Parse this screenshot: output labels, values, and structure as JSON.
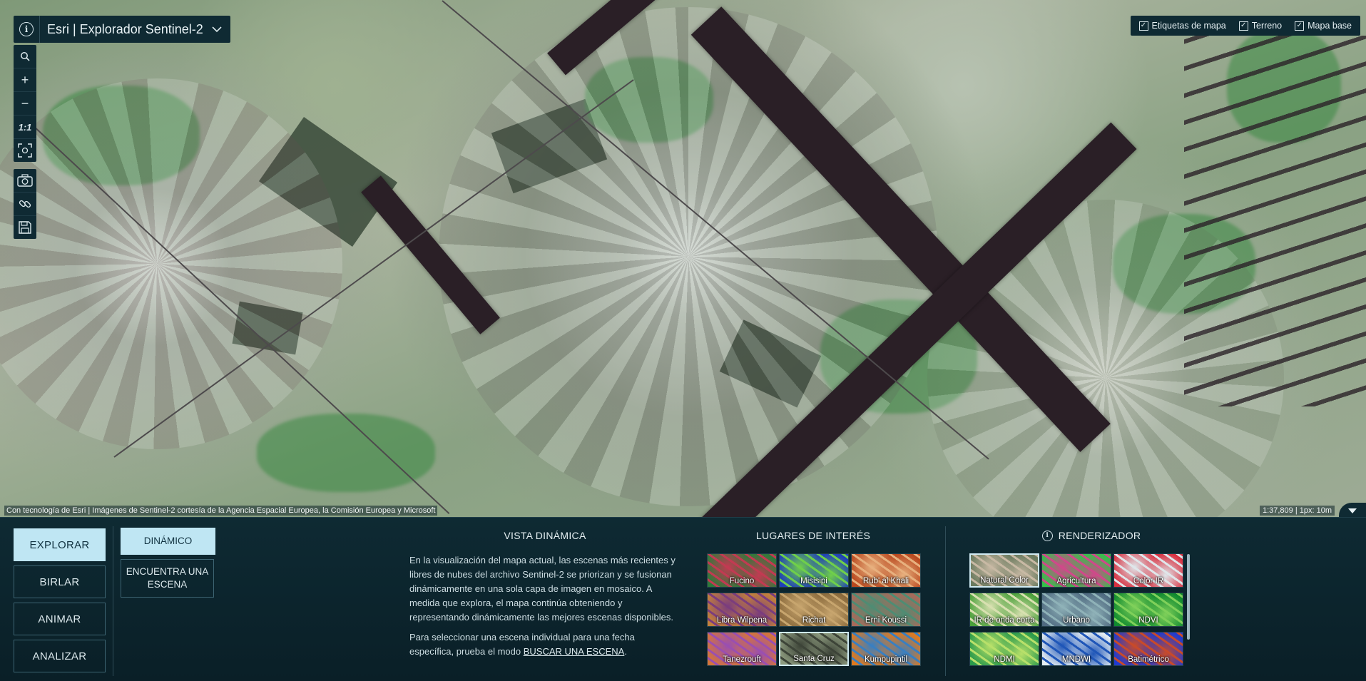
{
  "app": {
    "title": "Esri | Explorador Sentinel-2"
  },
  "map_tools": {
    "search": "search-icon",
    "zoom_in": "+",
    "zoom_out": "−",
    "scale_one": "1:1",
    "fullscreen": "fullscreen-icon",
    "screenshot": "camera-icon",
    "copy_link": "link-icon",
    "save": "save-icon"
  },
  "layer_toggles": [
    {
      "label": "Etiquetas de mapa",
      "checked": true
    },
    {
      "label": "Terreno",
      "checked": true
    },
    {
      "label": "Mapa base",
      "checked": true
    }
  ],
  "attribution": "Con tecnología de Esri | Imágenes de Sentinel-2 cortesía de la Agencia Espacial Europea, la Comisión Europea y Microsoft",
  "scale_text": "1:37,809 | 1px: 10m",
  "modes": [
    {
      "label": "EXPLORAR",
      "active": true
    },
    {
      "label": "BIRLAR",
      "active": false
    },
    {
      "label": "ANIMAR",
      "active": false
    },
    {
      "label": "ANALIZAR",
      "active": false
    }
  ],
  "submodes": [
    {
      "label": "DINÁMICO",
      "active": true
    },
    {
      "label": "ENCUENTRA UNA ESCENA",
      "active": false
    }
  ],
  "dynamic_view": {
    "title": "VISTA DINÁMICA",
    "paragraph1": "En la visualización del mapa actual, las escenas más recientes y libres de nubes del archivo Sentinel-2 se priorizan y se fusionan dinámicamente en una sola capa de imagen en mosaico. A medida que explora, el mapa continúa obteniendo y representando dinámicamente las mejores escenas disponibles.",
    "paragraph2_prefix": "Para seleccionar una escena individual para una fecha específica, prueba el modo ",
    "paragraph2_link": "BUSCAR UNA ESCENA",
    "paragraph2_suffix": "."
  },
  "places": {
    "title": "LUGARES DE INTERÉS",
    "items": [
      {
        "label": "Fucino",
        "c1": "#2e7a3a",
        "c2": "#c23a52"
      },
      {
        "label": "Misisipi",
        "c1": "#1f3fb8",
        "c2": "#6fcf4a"
      },
      {
        "label": "Rub' al Khali",
        "c1": "#b9481e",
        "c2": "#e7b07e"
      },
      {
        "label": "Libra Wilpena",
        "c1": "#c2803b",
        "c2": "#7b3d7d"
      },
      {
        "label": "Richat",
        "c1": "#8a6a3c",
        "c2": "#c7a56e"
      },
      {
        "label": "Erni Koussi",
        "c1": "#a86a5a",
        "c2": "#4f8c73"
      },
      {
        "label": "Tanezrouft",
        "c1": "#d5753a",
        "c2": "#9a4fb0"
      },
      {
        "label": "Santa Cruz",
        "c1": "#8c9a7e",
        "c2": "#3d4438",
        "selected": true
      },
      {
        "label": "Kumpupintil",
        "c1": "#e07a1e",
        "c2": "#3a7fc0"
      }
    ]
  },
  "renderer": {
    "title": "RENDERIZADOR",
    "info_icon": "info-icon",
    "items": [
      {
        "label": "Natural Color",
        "c1": "#6a7a5e",
        "c2": "#c8b9a4",
        "selected": true
      },
      {
        "label": "Agricultura",
        "c1": "#35c04a",
        "c2": "#d0488a"
      },
      {
        "label": "Color IR",
        "c1": "#d83040",
        "c2": "#dfe6ea"
      },
      {
        "label": "IR de onda corta",
        "c1": "#4aa03a",
        "c2": "#d8e0b0"
      },
      {
        "label": "Urbano",
        "c1": "#4f6a80",
        "c2": "#8fb2b8"
      },
      {
        "label": "NDVI",
        "c1": "#0f8a2e",
        "c2": "#7fd05a"
      },
      {
        "label": "NDMI",
        "c1": "#2a9a4a",
        "c2": "#b8e06a"
      },
      {
        "label": "MNDWI",
        "c1": "#e6eef2",
        "c2": "#1f56b8"
      },
      {
        "label": "Batimétrico",
        "c1": "#1f3bd0",
        "c2": "#c84a2a"
      }
    ]
  }
}
